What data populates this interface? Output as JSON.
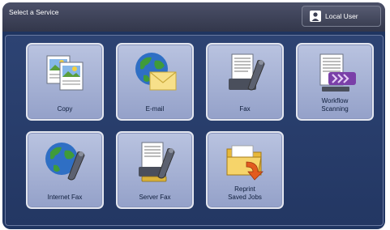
{
  "header": {
    "title": "Select a Service",
    "user_label": "Local User"
  },
  "services": {
    "copy": {
      "label": "Copy"
    },
    "email": {
      "label": "E-mail"
    },
    "fax": {
      "label": "Fax"
    },
    "workflow": {
      "line1": "Workflow",
      "line2": "Scanning"
    },
    "internet_fax": {
      "label": "Internet Fax"
    },
    "server_fax": {
      "label": "Server Fax"
    },
    "reprint": {
      "line1": "Reprint",
      "line2": "Saved Jobs"
    }
  },
  "icons": [
    "copy-icon",
    "email-icon",
    "fax-icon",
    "workflow-scanning-icon",
    "internet-fax-icon",
    "server-fax-icon",
    "reprint-saved-jobs-icon",
    "user-icon"
  ]
}
